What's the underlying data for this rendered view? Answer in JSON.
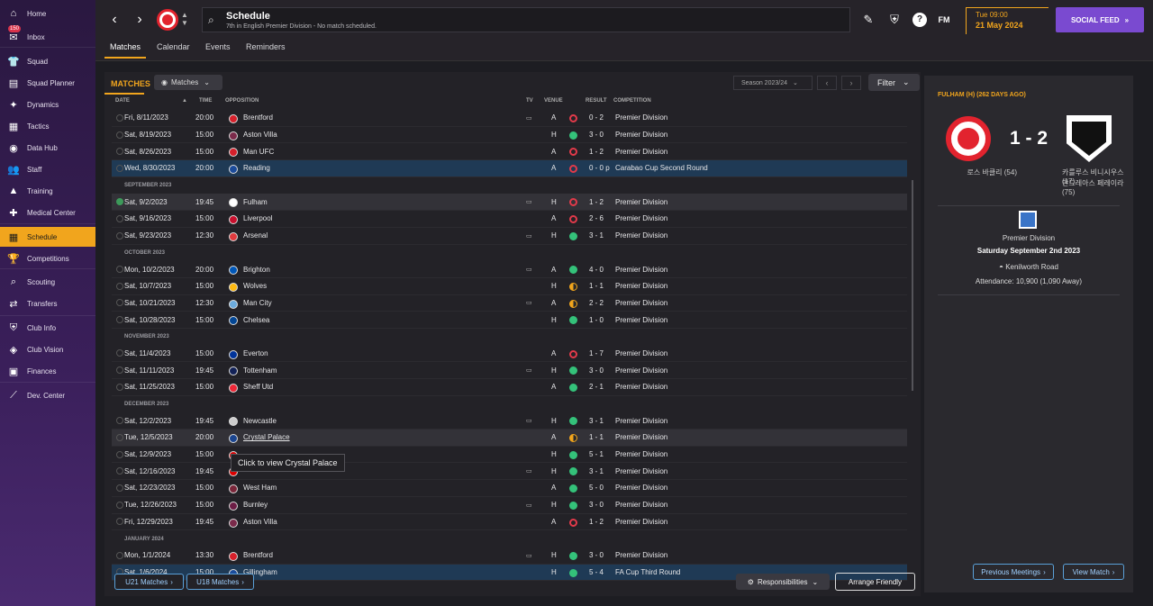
{
  "sidebar": {
    "inbox_badge": "150",
    "items": [
      {
        "label": "Home",
        "icon": "home-icon",
        "glyph": "⌂"
      },
      {
        "label": "Inbox",
        "icon": "inbox-icon",
        "glyph": "✉"
      },
      {
        "label": "Squad",
        "icon": "shirt-icon",
        "glyph": "👕"
      },
      {
        "label": "Squad Planner",
        "icon": "planner-icon",
        "glyph": "▤"
      },
      {
        "label": "Dynamics",
        "icon": "dynamics-icon",
        "glyph": "✦"
      },
      {
        "label": "Tactics",
        "icon": "tactics-icon",
        "glyph": "▦"
      },
      {
        "label": "Data Hub",
        "icon": "data-hub-icon",
        "glyph": "◉"
      },
      {
        "label": "Staff",
        "icon": "staff-icon",
        "glyph": "👥"
      },
      {
        "label": "Training",
        "icon": "training-icon",
        "glyph": "▲"
      },
      {
        "label": "Medical Center",
        "icon": "medical-icon",
        "glyph": "✚"
      },
      {
        "label": "Schedule",
        "icon": "calendar-icon",
        "glyph": "▦"
      },
      {
        "label": "Competitions",
        "icon": "trophy-icon",
        "glyph": "🏆"
      },
      {
        "label": "Scouting",
        "icon": "scouting-icon",
        "glyph": "⌕"
      },
      {
        "label": "Transfers",
        "icon": "transfers-icon",
        "glyph": "⇄"
      },
      {
        "label": "Club Info",
        "icon": "shield-icon",
        "glyph": "⛨"
      },
      {
        "label": "Club Vision",
        "icon": "vision-icon",
        "glyph": "◈"
      },
      {
        "label": "Finances",
        "icon": "finances-icon",
        "glyph": "▣"
      },
      {
        "label": "Dev. Center",
        "icon": "dev-center-icon",
        "glyph": "⟋"
      }
    ]
  },
  "header": {
    "title": "Schedule",
    "subtitle": "7th in English Premier Division - No match scheduled.",
    "time": "Tue 09:00",
    "date": "21 May 2024",
    "social_feed": "SOCIAL FEED",
    "fm": "FM"
  },
  "tabs": [
    "Matches",
    "Calendar",
    "Events",
    "Reminders"
  ],
  "toolbar": {
    "heading": "MATCHES",
    "view_dropdown": "Matches",
    "season": "Season 2023/24",
    "filter": "Filter"
  },
  "columns": {
    "date": "DATE",
    "time": "TIME",
    "opposition": "OPPOSITION",
    "tv": "TV",
    "venue": "VENUE",
    "result": "RESULT",
    "competition": "COMPETITION"
  },
  "rows": [
    {
      "date": "Fri, 8/11/2023",
      "time": "20:00",
      "opp": "Brentford",
      "crest": "#d6202b",
      "tv": true,
      "venue": "A",
      "res": "L",
      "score": "0 - 2",
      "comp": "Premier Division"
    },
    {
      "date": "Sat, 8/19/2023",
      "time": "15:00",
      "opp": "Aston Villa",
      "crest": "#7a2a4a",
      "tv": false,
      "venue": "H",
      "res": "W",
      "score": "3 - 0",
      "comp": "Premier Division"
    },
    {
      "date": "Sat, 8/26/2023",
      "time": "15:00",
      "opp": "Man UFC",
      "crest": "#d6202b",
      "tv": false,
      "venue": "A",
      "res": "L",
      "score": "1 - 2",
      "comp": "Premier Division"
    },
    {
      "date": "Wed, 8/30/2023",
      "time": "20:00",
      "opp": "Reading",
      "crest": "#1b4b9a",
      "tv": false,
      "venue": "A",
      "res": "L",
      "score": "0 - 0 p",
      "comp": "Carabao Cup Second Round",
      "hl": true
    },
    {
      "month": "SEPTEMBER 2023"
    },
    {
      "date": "Sat, 9/2/2023",
      "time": "19:45",
      "opp": "Fulham",
      "crest": "#ffffff",
      "tv": true,
      "venue": "H",
      "res": "L",
      "score": "1 - 2",
      "comp": "Premier Division",
      "sel": true,
      "done": true
    },
    {
      "date": "Sat, 9/16/2023",
      "time": "15:00",
      "opp": "Liverpool",
      "crest": "#c8102e",
      "tv": false,
      "venue": "A",
      "res": "L",
      "score": "2 - 6",
      "comp": "Premier Division"
    },
    {
      "date": "Sat, 9/23/2023",
      "time": "12:30",
      "opp": "Arsenal",
      "crest": "#e03a3e",
      "tv": true,
      "venue": "H",
      "res": "W",
      "score": "3 - 1",
      "comp": "Premier Division"
    },
    {
      "month": "OCTOBER 2023"
    },
    {
      "date": "Mon, 10/2/2023",
      "time": "20:00",
      "opp": "Brighton",
      "crest": "#0057b8",
      "tv": true,
      "venue": "A",
      "res": "W",
      "score": "4 - 0",
      "comp": "Premier Division"
    },
    {
      "date": "Sat, 10/7/2023",
      "time": "15:00",
      "opp": "Wolves",
      "crest": "#fdb913",
      "tv": false,
      "venue": "H",
      "res": "D",
      "score": "1 - 1",
      "comp": "Premier Division"
    },
    {
      "date": "Sat, 10/21/2023",
      "time": "12:30",
      "opp": "Man City",
      "crest": "#6cabdd",
      "tv": true,
      "venue": "A",
      "res": "D",
      "score": "2 - 2",
      "comp": "Premier Division"
    },
    {
      "date": "Sat, 10/28/2023",
      "time": "15:00",
      "opp": "Chelsea",
      "crest": "#034694",
      "tv": false,
      "venue": "H",
      "res": "W",
      "score": "1 - 0",
      "comp": "Premier Division"
    },
    {
      "month": "NOVEMBER 2023"
    },
    {
      "date": "Sat, 11/4/2023",
      "time": "15:00",
      "opp": "Everton",
      "crest": "#003399",
      "tv": false,
      "venue": "A",
      "res": "L",
      "score": "1 - 7",
      "comp": "Premier Division"
    },
    {
      "date": "Sat, 11/11/2023",
      "time": "19:45",
      "opp": "Tottenham",
      "crest": "#132257",
      "tv": true,
      "venue": "H",
      "res": "W",
      "score": "3 - 0",
      "comp": "Premier Division"
    },
    {
      "date": "Sat, 11/25/2023",
      "time": "15:00",
      "opp": "Sheff Utd",
      "crest": "#ee2737",
      "tv": false,
      "venue": "A",
      "res": "W",
      "score": "2 - 1",
      "comp": "Premier Division"
    },
    {
      "month": "DECEMBER 2023"
    },
    {
      "date": "Sat, 12/2/2023",
      "time": "19:45",
      "opp": "Newcastle",
      "crest": "#cccccc",
      "tv": true,
      "venue": "H",
      "res": "W",
      "score": "3 - 1",
      "comp": "Premier Division"
    },
    {
      "date": "Tue, 12/5/2023",
      "time": "20:00",
      "opp": "Crystal Palace",
      "crest": "#1b458f",
      "tv": false,
      "venue": "A",
      "res": "D",
      "score": "1 - 1",
      "comp": "Premier Division",
      "sel": true,
      "link": true
    },
    {
      "date": "Sat, 12/9/2023",
      "time": "15:00",
      "opp": "",
      "crest": "#dd0000",
      "tv": false,
      "venue": "H",
      "res": "W",
      "score": "5 - 1",
      "comp": "Premier Division"
    },
    {
      "date": "Sat, 12/16/2023",
      "time": "19:45",
      "opp": "",
      "crest": "#dd0000",
      "tv": true,
      "venue": "H",
      "res": "W",
      "score": "3 - 1",
      "comp": "Premier Division"
    },
    {
      "date": "Sat, 12/23/2023",
      "time": "15:00",
      "opp": "West Ham",
      "crest": "#7a263a",
      "tv": false,
      "venue": "A",
      "res": "W",
      "score": "5 - 0",
      "comp": "Premier Division"
    },
    {
      "date": "Tue, 12/26/2023",
      "time": "15:00",
      "opp": "Burnley",
      "crest": "#6c1d45",
      "tv": true,
      "venue": "H",
      "res": "W",
      "score": "3 - 0",
      "comp": "Premier Division"
    },
    {
      "date": "Fri, 12/29/2023",
      "time": "19:45",
      "opp": "Aston Villa",
      "crest": "#7a2a4a",
      "tv": false,
      "venue": "A",
      "res": "L",
      "score": "1 - 2",
      "comp": "Premier Division"
    },
    {
      "month": "JANUARY 2024"
    },
    {
      "date": "Mon, 1/1/2024",
      "time": "13:30",
      "opp": "Brentford",
      "crest": "#d6202b",
      "tv": true,
      "venue": "H",
      "res": "W",
      "score": "3 - 0",
      "comp": "Premier Division"
    },
    {
      "date": "Sat, 1/6/2024",
      "time": "15:00",
      "opp": "Gillingham",
      "crest": "#1b4b9a",
      "tv": false,
      "venue": "H",
      "res": "W",
      "score": "5 - 4",
      "comp": "FA Cup Third Round",
      "hl": true
    }
  ],
  "tooltip": "Click to view Crystal Palace",
  "footer": {
    "u21": "U21 Matches",
    "u18": "U18 Matches",
    "responsibilities": "Responsibilities",
    "arrange": "Arrange Friendly"
  },
  "panel": {
    "title": "FULHAM (H) (262 DAYS AGO)",
    "score": "1 - 2",
    "home_scorer": "로스 바클리 (54)",
    "away_scorer_1": "카를루스 비니시우스 (17)",
    "away_scorer_2": "안드레아스 페레이라 (75)",
    "competition": "Premier Division",
    "date": "Saturday September 2nd 2023",
    "venue": "Kenilworth Road",
    "attendance": "Attendance: 10,900 (1,090 Away)",
    "prev_meetings": "Previous Meetings",
    "view_match": "View Match"
  },
  "colors": {
    "accent": "#f1a51d",
    "win": "#34c27a",
    "loss": "#e23a4a",
    "purple": "#7a4ad0"
  }
}
